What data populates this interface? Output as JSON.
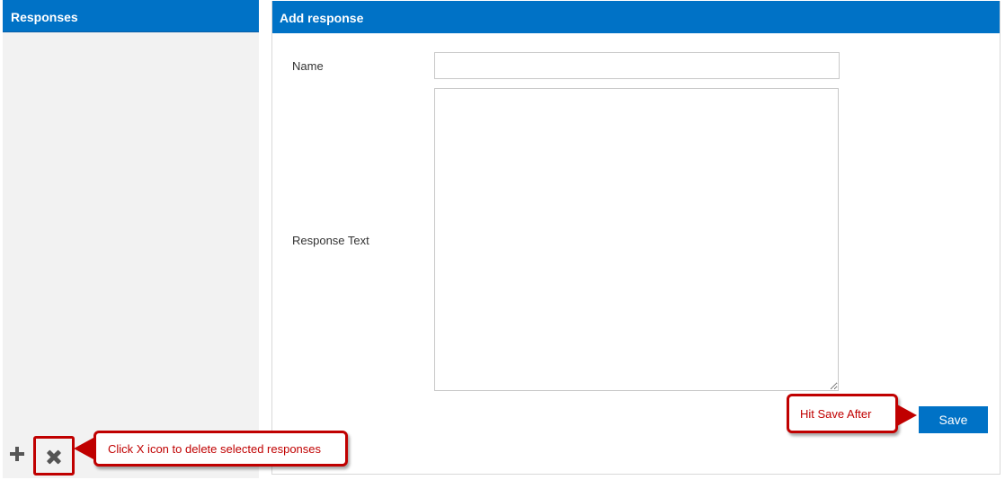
{
  "left_panel": {
    "title": "Responses",
    "toolbar": {
      "add_icon": "plus-icon",
      "delete_icon": "x-icon"
    }
  },
  "right_panel": {
    "title": "Add response",
    "form": {
      "name_label": "Name",
      "name_value": "",
      "response_text_label": "Response Text",
      "response_text_value": "",
      "save_label": "Save"
    }
  },
  "annotations": {
    "delete_callout": "Click X icon to delete selected responses",
    "save_callout": "Hit Save After"
  },
  "colors": {
    "header_blue": "#0072c6",
    "callout_red": "#c00000",
    "panel_gray": "#f2f2f2"
  }
}
